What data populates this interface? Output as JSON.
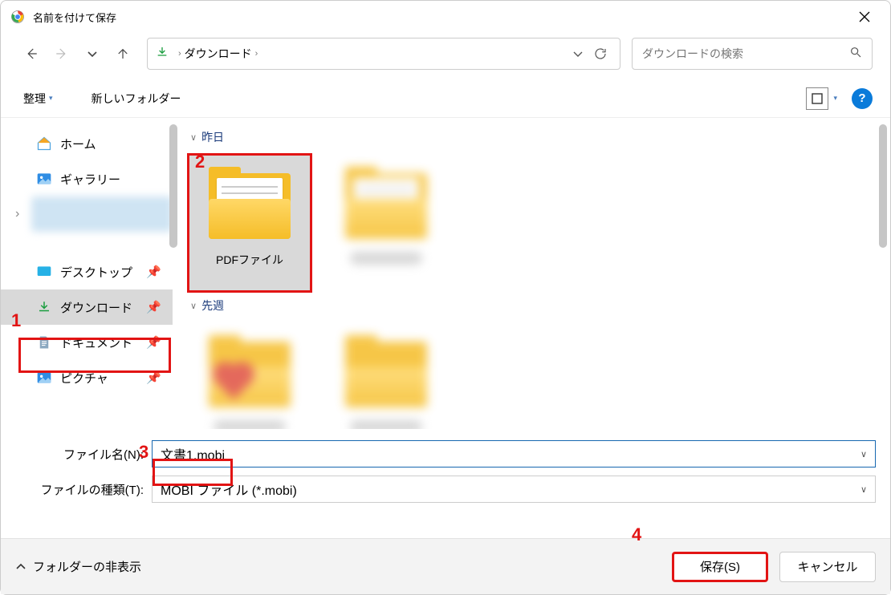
{
  "window": {
    "title": "名前を付けて保存"
  },
  "path": {
    "crumb": "ダウンロード"
  },
  "search": {
    "placeholder": "ダウンロードの検索"
  },
  "toolbar": {
    "organize": "整理",
    "newFolder": "新しいフォルダー"
  },
  "sidebar": {
    "home": "ホーム",
    "gallery": "ギャラリー",
    "desktop": "デスクトップ",
    "downloads": "ダウンロード",
    "documents": "ドキュメント",
    "pictures": "ピクチャ"
  },
  "groups": {
    "yesterday": "昨日",
    "lastWeek": "先週"
  },
  "files": {
    "pdfFolder": "PDFファイル"
  },
  "fields": {
    "filenameLabel": "ファイル名(N):",
    "filenameValue": "文書1.mobi",
    "typeLabel": "ファイルの種類(T):",
    "typeValue": "MOBI ファイル (*.mobi)"
  },
  "footer": {
    "hideFolders": "フォルダーの非表示",
    "save": "保存(S)",
    "cancel": "キャンセル"
  },
  "annotations": {
    "a1": "1",
    "a2": "2",
    "a3": "3",
    "a4": "4"
  }
}
